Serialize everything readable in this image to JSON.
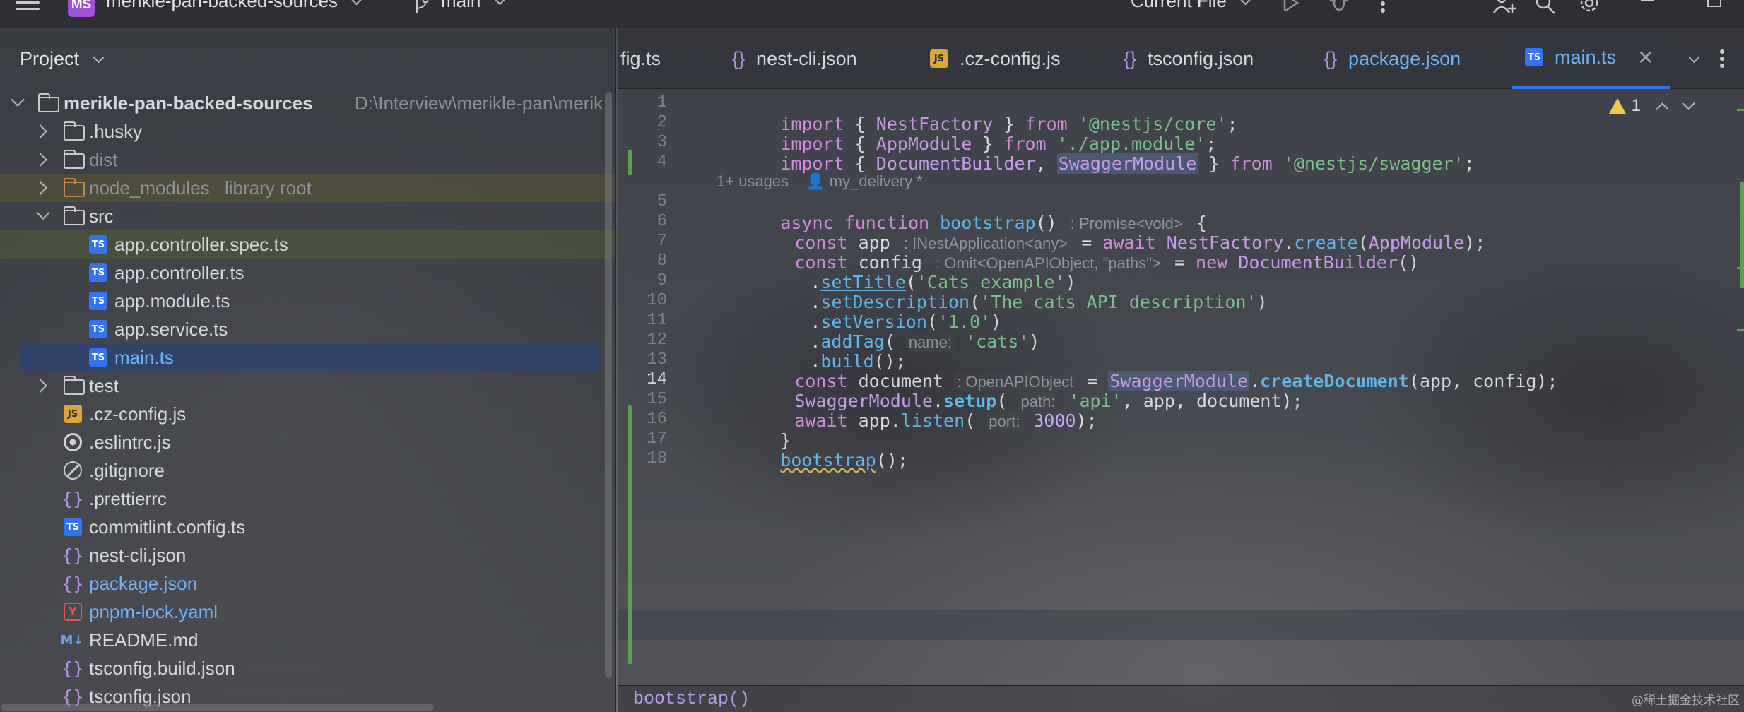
{
  "titlebar": {
    "project_badge": "MS",
    "project_name": "merikle-pan-backed-sources",
    "branch": "main",
    "run_config": "Current File"
  },
  "project_panel": {
    "title": "Project",
    "tree": [
      {
        "label": "merikle-pan-backed-sources",
        "note": "D:\\Interview\\merikle-pan\\merik"
      },
      {
        "label": ".husky"
      },
      {
        "label": "dist"
      },
      {
        "label": "node_modules",
        "note": "library root"
      },
      {
        "label": "src"
      },
      {
        "label": "app.controller.spec.ts"
      },
      {
        "label": "app.controller.ts"
      },
      {
        "label": "app.module.ts"
      },
      {
        "label": "app.service.ts"
      },
      {
        "label": "main.ts"
      },
      {
        "label": "test"
      },
      {
        "label": ".cz-config.js"
      },
      {
        "label": ".eslintrc.js"
      },
      {
        "label": ".gitignore"
      },
      {
        "label": ".prettierrc"
      },
      {
        "label": "commitlint.config.ts"
      },
      {
        "label": "nest-cli.json"
      },
      {
        "label": "package.json"
      },
      {
        "label": "pnpm-lock.yaml"
      },
      {
        "label": "README.md"
      },
      {
        "label": "tsconfig.build.json"
      },
      {
        "label": "tsconfig.json"
      }
    ]
  },
  "tabs": [
    {
      "label": "fig.ts"
    },
    {
      "label": "nest-cli.json"
    },
    {
      "label": ".cz-config.js"
    },
    {
      "label": "tsconfig.json"
    },
    {
      "label": "package.json"
    },
    {
      "label": "main.ts",
      "active": true
    }
  ],
  "editor": {
    "warnings_count": "1",
    "current_line": 14,
    "usage_hint": "1+ usages",
    "author_hint": "my_delivery *",
    "line_numbers": [
      "1",
      "2",
      "3",
      "4",
      "5",
      "6",
      "7",
      "8",
      "9",
      "10",
      "11",
      "12",
      "13",
      "14",
      "15",
      "16",
      "17",
      "18"
    ],
    "code": {
      "l1": {
        "kw1": "import",
        "t1": " { ",
        "cls": "NestFactory",
        "t2": " } ",
        "kw2": "from",
        "t3": " ",
        "str": "'@nestjs/core'",
        "t4": ";"
      },
      "l2": {
        "kw1": "import",
        "t1": " { ",
        "cls": "AppModule",
        "t2": " } ",
        "kw2": "from",
        "t3": " ",
        "str": "'./app.module'",
        "t4": ";"
      },
      "l3": {
        "kw1": "import",
        "t1": " { ",
        "cls1": "DocumentBuilder",
        "t2": ", ",
        "cls2": "SwaggerModule",
        "t3": " } ",
        "kw2": "from",
        "t4": " ",
        "str": "'@nestjs/swagger'",
        "t5": ";"
      },
      "l5": {
        "kw1": "async",
        "t1": " ",
        "kw2": "function",
        "t2": " ",
        "fn": "bootstrap",
        "t3": "()",
        "hint": ": Promise<void>",
        "t4": " {"
      },
      "l6": {
        "kw1": "const",
        "t1": " app",
        "hint": ": INestApplication<any>",
        "t2": " = ",
        "kw2": "await",
        "t3": " ",
        "cls": "NestFactory",
        "t4": ".",
        "fn": "create",
        "t5": "(",
        "cls2": "AppModule",
        "t6": ");"
      },
      "l7": {
        "kw1": "const",
        "t1": " config",
        "hint": ": Omit<OpenAPIObject, \"paths\">",
        "t2": " = ",
        "kw2": "new",
        "t3": " ",
        "cls": "DocumentBuilder",
        "t4": "()"
      },
      "l8": {
        "t1": ".",
        "fn": "setTitle",
        "t2": "(",
        "str": "'Cats example'",
        "t3": ")"
      },
      "l9": {
        "t1": ".",
        "fn": "setDescription",
        "t2": "(",
        "str": "'The cats API description'",
        "t3": ")"
      },
      "l10": {
        "t1": ".",
        "fn": "setVersion",
        "t2": "(",
        "str": "'1.0'",
        "t3": ")"
      },
      "l11": {
        "t1": ".",
        "fn": "addTag",
        "t2": "(",
        "hint": "name:",
        "str": "'cats'",
        "t3": ")"
      },
      "l12": {
        "t1": ".",
        "fn": "build",
        "t2": "();"
      },
      "l13": {
        "kw1": "const",
        "t1": " document",
        "hint": ": OpenAPIObject",
        "t2": " = ",
        "cls": "SwaggerModule",
        "t3": ".",
        "fn": "createDocument",
        "t4": "(app, config);"
      },
      "l14": {
        "cls": "SwaggerModule",
        "t1": ".",
        "fn": "setup",
        "t2": "(",
        "hint": "path:",
        "str": "'api'",
        "t3": ", app, document);"
      },
      "l15": {
        "kw1": "await",
        "t1": " app.",
        "fn": "listen",
        "t2": "(",
        "hint": "port:",
        "num": "3000",
        "t3": ");"
      },
      "l16": {
        "t1": "}"
      },
      "l17": {
        "fn": "bootstrap",
        "t1": "();"
      }
    }
  },
  "breadcrumb": "bootstrap()",
  "watermark": "@稀土掘金技术社区",
  "colors": {
    "accent": "#3574f0",
    "keyword": "#d28bde",
    "function": "#5fb6e8",
    "string": "#7cc08a",
    "change_bar": "#5ba14f"
  }
}
